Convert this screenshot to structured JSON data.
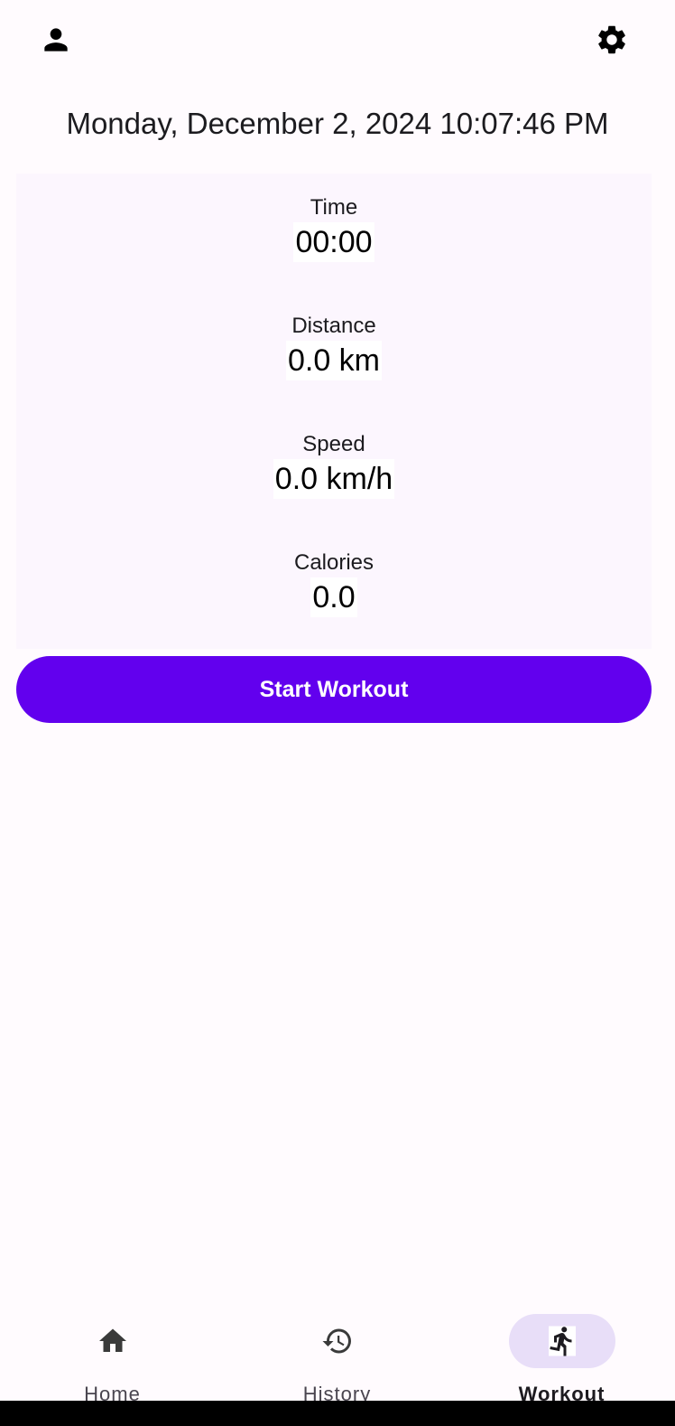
{
  "header": {
    "profile_icon": "person-icon",
    "settings_icon": "gear-icon"
  },
  "datetime": "Monday, December 2, 2024 10:07:46 PM",
  "stats": {
    "time": {
      "label": "Time",
      "value": "00:00"
    },
    "distance": {
      "label": "Distance",
      "value": "0.0 km"
    },
    "speed": {
      "label": "Speed",
      "value": "0.0 km/h"
    },
    "calories": {
      "label": "Calories",
      "value": "0.0"
    }
  },
  "start_button_label": "Start Workout",
  "bottom_nav": {
    "items": [
      {
        "label": "Home",
        "icon": "home-icon",
        "active": false
      },
      {
        "label": "History",
        "icon": "history-icon",
        "active": false
      },
      {
        "label": "Workout",
        "icon": "running-icon",
        "active": true
      }
    ]
  },
  "colors": {
    "primary": "#6200EE",
    "background": "#FFFBFE",
    "card": "#FCF6FE",
    "nav_indicator": "#E8DEF8",
    "text": "#1C1B1F"
  }
}
